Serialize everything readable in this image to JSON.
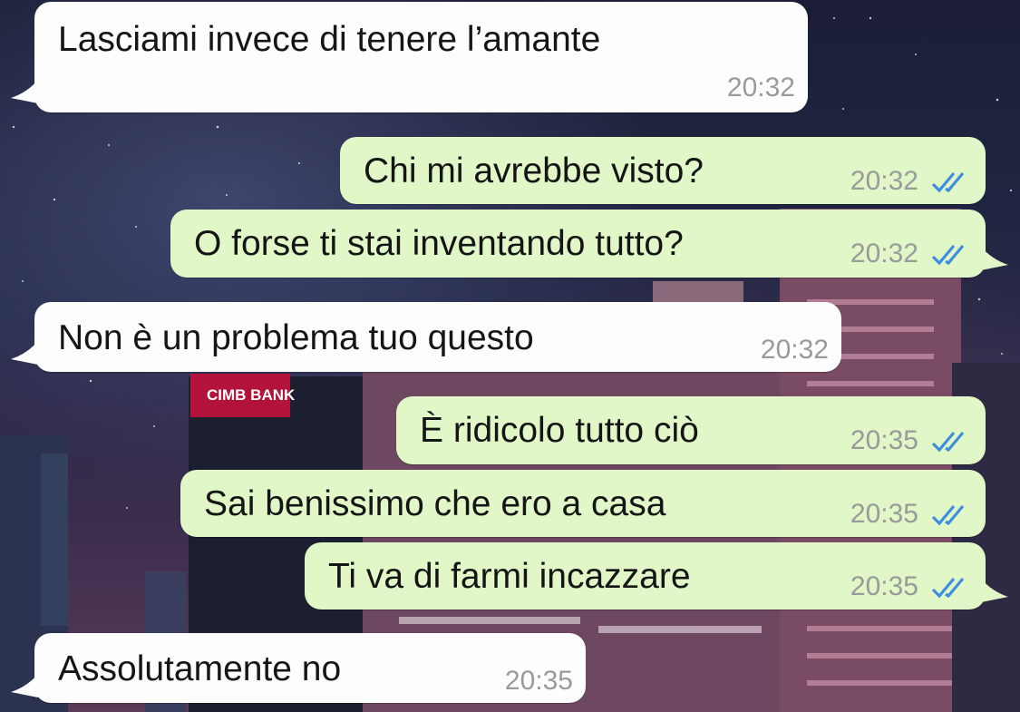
{
  "bank_sign": "CIMB BANK",
  "colors": {
    "incoming": "#fdfdfd",
    "outgoing": "#e1f7c8",
    "tick": "#3f8ede",
    "time": "#9a9a9a"
  },
  "messages": [
    {
      "text": "Lasciami invece di tenere l’amante",
      "time": "20:32",
      "direction": "incoming"
    },
    {
      "text": "Chi mi avrebbe visto?",
      "time": "20:32",
      "direction": "outgoing",
      "status": "read"
    },
    {
      "text": "O forse ti stai inventando tutto?",
      "time": "20:32",
      "direction": "outgoing",
      "status": "read"
    },
    {
      "text": "Non è un problema tuo questo",
      "time": "20:32",
      "direction": "incoming"
    },
    {
      "text": "È ridicolo tutto ciò",
      "time": "20:35",
      "direction": "outgoing",
      "status": "read"
    },
    {
      "text": "Sai benissimo che ero a casa",
      "time": "20:35",
      "direction": "outgoing",
      "status": "read"
    },
    {
      "text": "Ti va di farmi incazzare",
      "time": "20:35",
      "direction": "outgoing",
      "status": "read"
    },
    {
      "text": "Assolutamente no",
      "time": "20:35",
      "direction": "incoming"
    }
  ]
}
